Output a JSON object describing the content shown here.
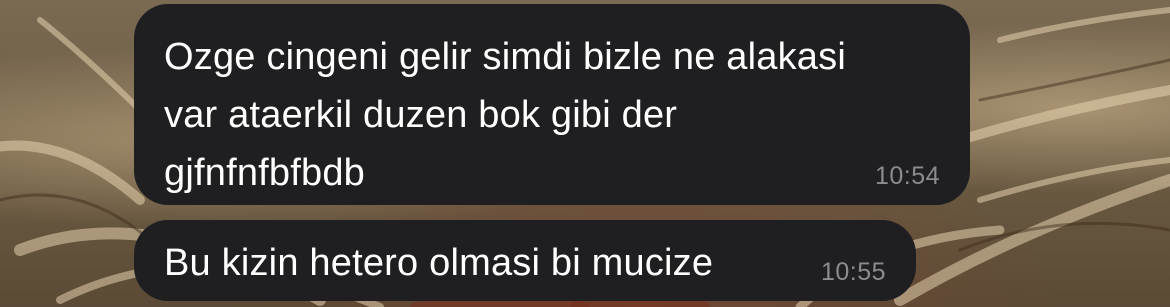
{
  "chat": {
    "messages": [
      {
        "text": "Ozge cingeni gelir simdi bizle ne alakasi\nvar ataerkil duzen bok gibi der\ngjfnfnfbfbdb",
        "time": "10:54"
      },
      {
        "text": "Bu kizin hetero olmasi bi mucize",
        "time": "10:55"
      }
    ]
  },
  "colors": {
    "bubble_background": "#1f1f21",
    "message_text": "#ffffff",
    "timestamp_text": "#8c8c8e",
    "wallpaper_base": "#6f5f48"
  },
  "icons": {
    "wallpaper": "botanical-illustration"
  }
}
